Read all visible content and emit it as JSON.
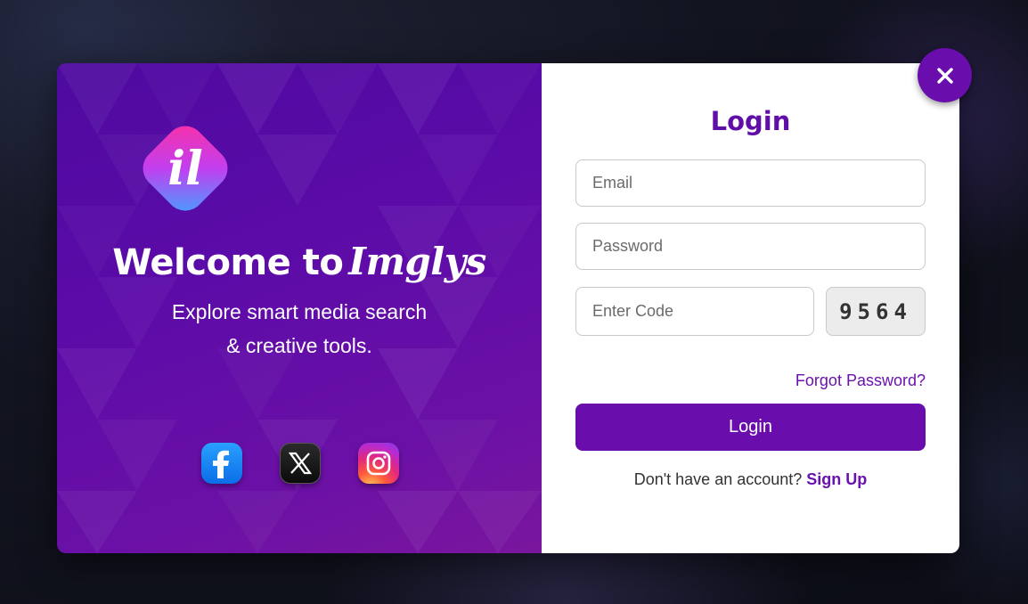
{
  "brand": {
    "welcome_prefix": "Welcome to",
    "name": "Imglys",
    "logo_letters": "il",
    "tagline_line1": "Explore smart media search",
    "tagline_line2": "& creative tools."
  },
  "socials": [
    {
      "name": "facebook",
      "icon": "facebook-icon"
    },
    {
      "name": "x",
      "icon": "x-icon"
    },
    {
      "name": "instagram",
      "icon": "instagram-icon"
    }
  ],
  "login": {
    "title": "Login",
    "email_placeholder": "Email",
    "password_placeholder": "Password",
    "code_placeholder": "Enter Code",
    "captcha": "9564",
    "forgot": "Forgot Password?",
    "submit": "Login",
    "signup_prompt": "Don't have an account?",
    "signup_link": "Sign Up"
  },
  "close": {
    "icon": "close-icon"
  },
  "colors": {
    "accent": "#6a0dad",
    "panel_purple": "#5c0ba8",
    "white": "#ffffff"
  }
}
